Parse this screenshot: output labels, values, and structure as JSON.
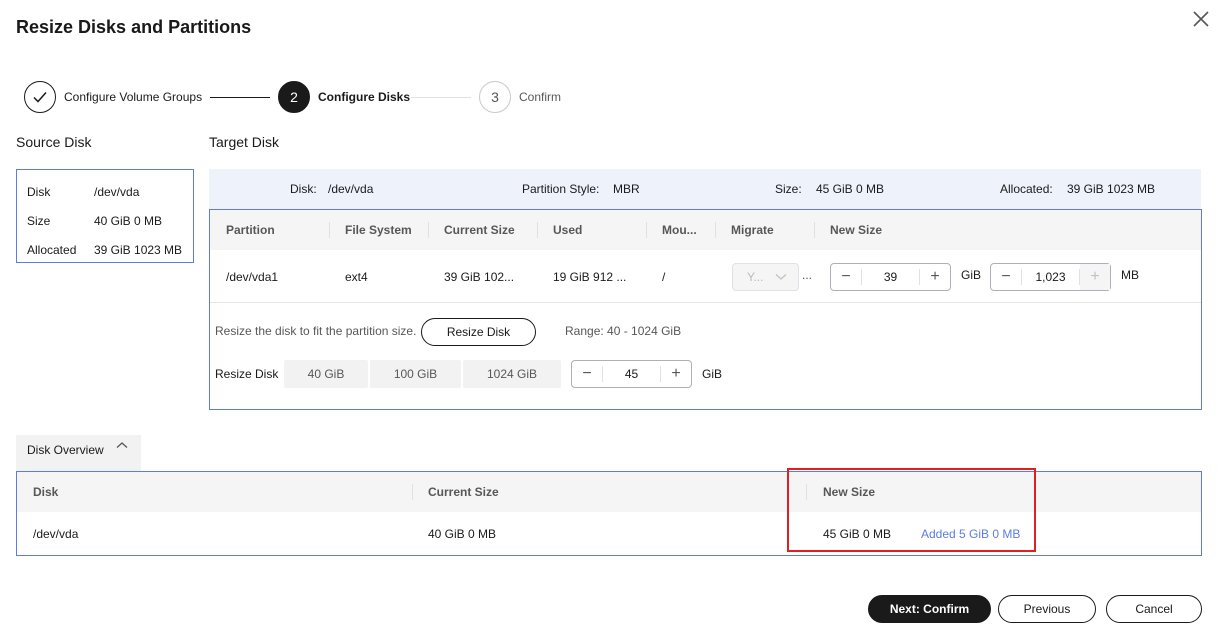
{
  "dialog": {
    "title": "Resize Disks and Partitions"
  },
  "steps": [
    {
      "label": "Configure Volume Groups",
      "number": "",
      "state": "done"
    },
    {
      "label": "Configure Disks",
      "number": "2",
      "state": "active"
    },
    {
      "label": "Confirm",
      "number": "3",
      "state": "todo"
    }
  ],
  "source": {
    "heading": "Source Disk",
    "rows": [
      {
        "key": "Disk",
        "value": "/dev/vda"
      },
      {
        "key": "Size",
        "value": "40 GiB 0 MB"
      },
      {
        "key": "Allocated",
        "value": "39 GiB 1023 MB"
      }
    ]
  },
  "target": {
    "heading": "Target Disk",
    "disk_label": "Disk:",
    "disk_value": "/dev/vda",
    "style_label": "Partition Style:",
    "style_value": "MBR",
    "size_label": "Size:",
    "size_value": "45 GiB 0 MB",
    "allocated_label": "Allocated:",
    "allocated_value": "39 GiB 1023 MB"
  },
  "partition_table": {
    "columns": [
      "Partition",
      "File System",
      "Current Size",
      "Used",
      "Mou...",
      "Migrate",
      "New Size"
    ],
    "row": {
      "partition": "/dev/vda1",
      "fs": "ext4",
      "current": "39 GiB 102...",
      "used": "19 GiB 912 ...",
      "mount": "/",
      "migrate": "Y...",
      "migrate_more": "...",
      "gib_value": "39",
      "gib_unit": "GiB",
      "mb_value": "1,023",
      "mb_unit": "MB"
    }
  },
  "resize": {
    "hint": "Resize the disk to fit the partition size.",
    "button": "Resize Disk",
    "range": "Range: 40  -  1024  GiB",
    "label": "Resize Disk",
    "options": [
      "40 GiB",
      "100 GiB",
      "1024 GiB"
    ],
    "value": "45",
    "unit": "GiB"
  },
  "overview": {
    "tab": "Disk Overview",
    "columns": [
      "Disk",
      "Current Size",
      "New Size"
    ],
    "row": {
      "disk": "/dev/vda",
      "current": "40 GiB 0 MB",
      "new": "45 GiB 0 MB",
      "added": "Added 5 GiB 0 MB"
    }
  },
  "footer": {
    "next": "Next: Confirm",
    "previous": "Previous",
    "cancel": "Cancel"
  },
  "colors": {
    "accent": "#5e7ce0",
    "highlight": "#e02020",
    "dark": "#1a1a1a"
  }
}
